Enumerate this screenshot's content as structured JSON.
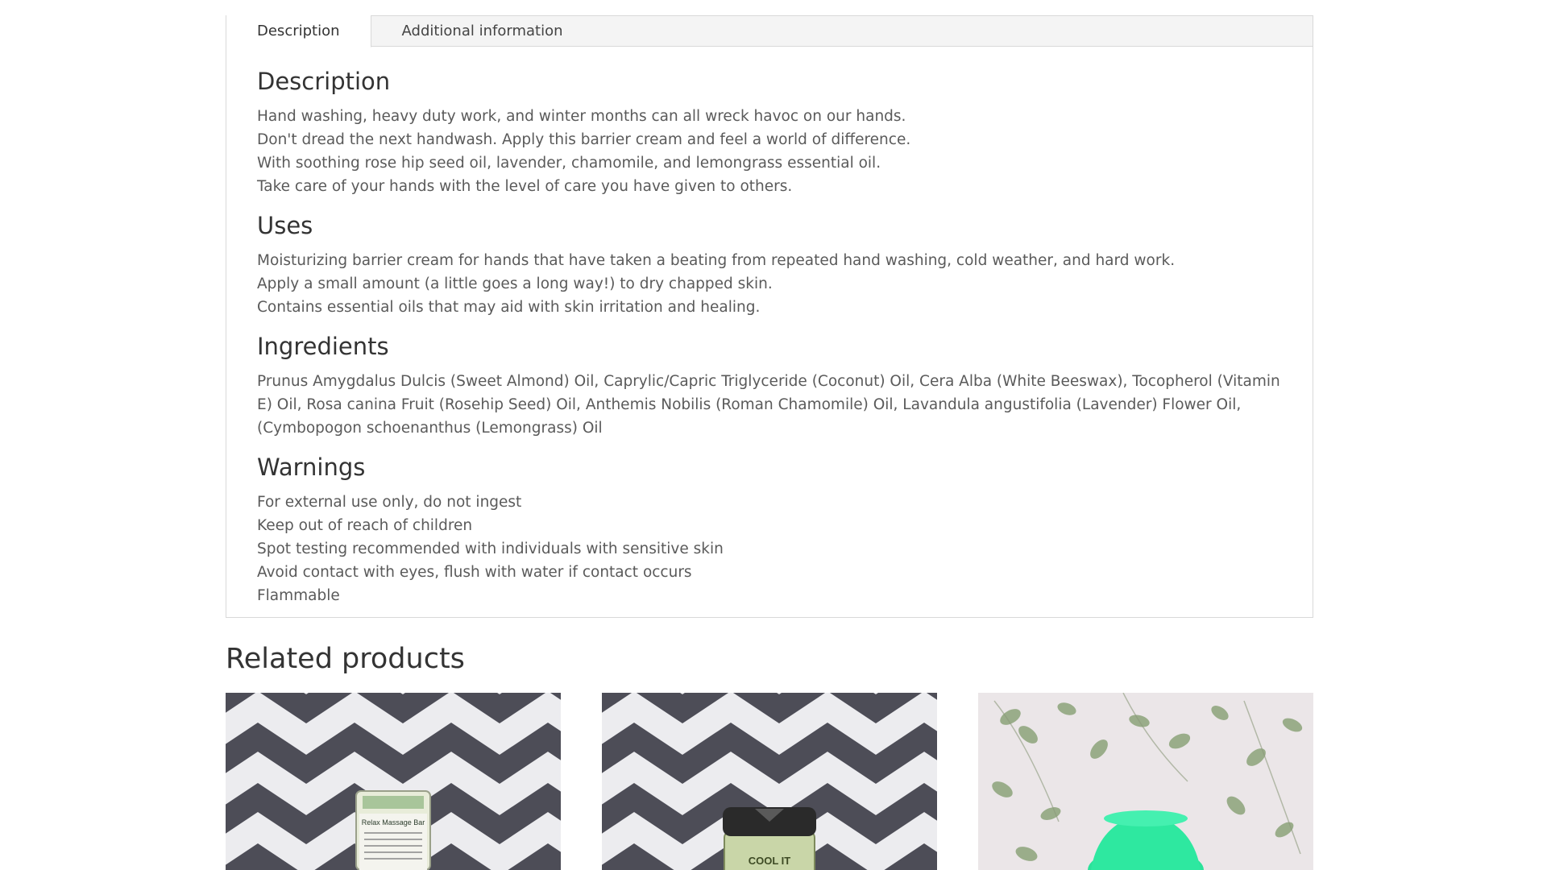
{
  "tabs": [
    {
      "label": "Description",
      "active": true
    },
    {
      "label": "Additional information",
      "active": false
    }
  ],
  "description": {
    "heading": "Description",
    "lines": [
      "Hand washing, heavy duty work, and winter months can all wreck havoc on our hands.",
      "Don't dread the next handwash. Apply this barrier cream and feel a world of difference.",
      "With soothing rose hip seed oil, lavender, chamomile, and lemongrass essential oil.",
      "Take care of your hands with the level of care you have given to others."
    ]
  },
  "uses": {
    "heading": "Uses",
    "lines": [
      "Moisturizing barrier cream for hands that have taken a beating from repeated hand washing, cold weather, and hard work.",
      "Apply a small amount (a little goes a long way!) to dry chapped skin.",
      "Contains essential oils that may aid with skin irritation and healing."
    ]
  },
  "ingredients": {
    "heading": "Ingredients",
    "text": "Prunus Amygdalus Dulcis (Sweet Almond) Oil, Caprylic/Capric Triglyceride (Coconut) Oil, Cera Alba (White Beeswax), Tocopherol (Vitamin E) Oil, Rosa canina Fruit (Rosehip Seed) Oil, Anthemis Nobilis (Roman Chamomile) Oil, Lavandula angustifolia (Lavender) Flower Oil, (Cymbopogon schoenanthus (Lemongrass) Oil"
  },
  "warnings": {
    "heading": "Warnings",
    "lines": [
      "For external use only, do not ingest",
      "Keep out of reach of children",
      "Spot testing recommended with individuals with sensitive skin",
      "Avoid contact with eyes, flush with water if contact occurs",
      "Flammable"
    ]
  },
  "related": {
    "title": "Related products",
    "products": [
      {
        "image": "product-image-massage-bar",
        "label_text": "Relax Massage Bar"
      },
      {
        "image": "product-image-cool-it-jar",
        "label_text": "COOL IT"
      },
      {
        "image": "product-image-green-soap"
      }
    ]
  },
  "colors": {
    "tab_bar_bg": "#f4f4f4",
    "border": "#d9d9d9",
    "heading_text": "#333333",
    "body_text": "#5a5a5a",
    "chevron_dark": "#4a4a55",
    "soap_green": "#2ee8a0"
  }
}
